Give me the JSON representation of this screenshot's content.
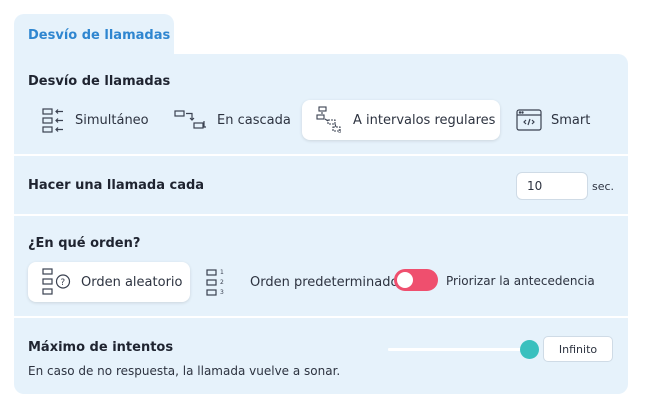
{
  "tab": {
    "label": "Desvío de llamadas"
  },
  "forwarding": {
    "title": "Desvío de llamadas",
    "options": [
      {
        "label": "Simultáneo",
        "icon": "simultaneous-icon"
      },
      {
        "label": "En cascada",
        "icon": "cascade-icon"
      },
      {
        "label": "A intervalos regulares",
        "icon": "regular-intervals-icon"
      },
      {
        "label": "Smart",
        "icon": "smart-code-icon"
      }
    ],
    "selected": "A intervalos regulares"
  },
  "interval": {
    "title": "Hacer una llamada cada",
    "value": "10",
    "unit": "sec."
  },
  "order": {
    "title": "¿En qué orden?",
    "options": [
      {
        "label": "Orden aleatorio",
        "icon": "random-order-icon"
      },
      {
        "label": "Orden predeterminado",
        "icon": "default-order-icon"
      }
    ],
    "selected": "Orden aleatorio",
    "toggle_label": "Priorizar la antecedencia",
    "toggle_on": true
  },
  "attempts": {
    "title": "Máximo de intentos",
    "subtitle": "En caso de no respuesta, la llamada vuelve a sonar.",
    "button_label": "Infinito",
    "slider_fraction": 1.0
  },
  "colors": {
    "accent": "#2f86d0",
    "panel": "#e6f2fb",
    "toggle": "#ef4f6e",
    "slider_thumb": "#39c0be"
  }
}
